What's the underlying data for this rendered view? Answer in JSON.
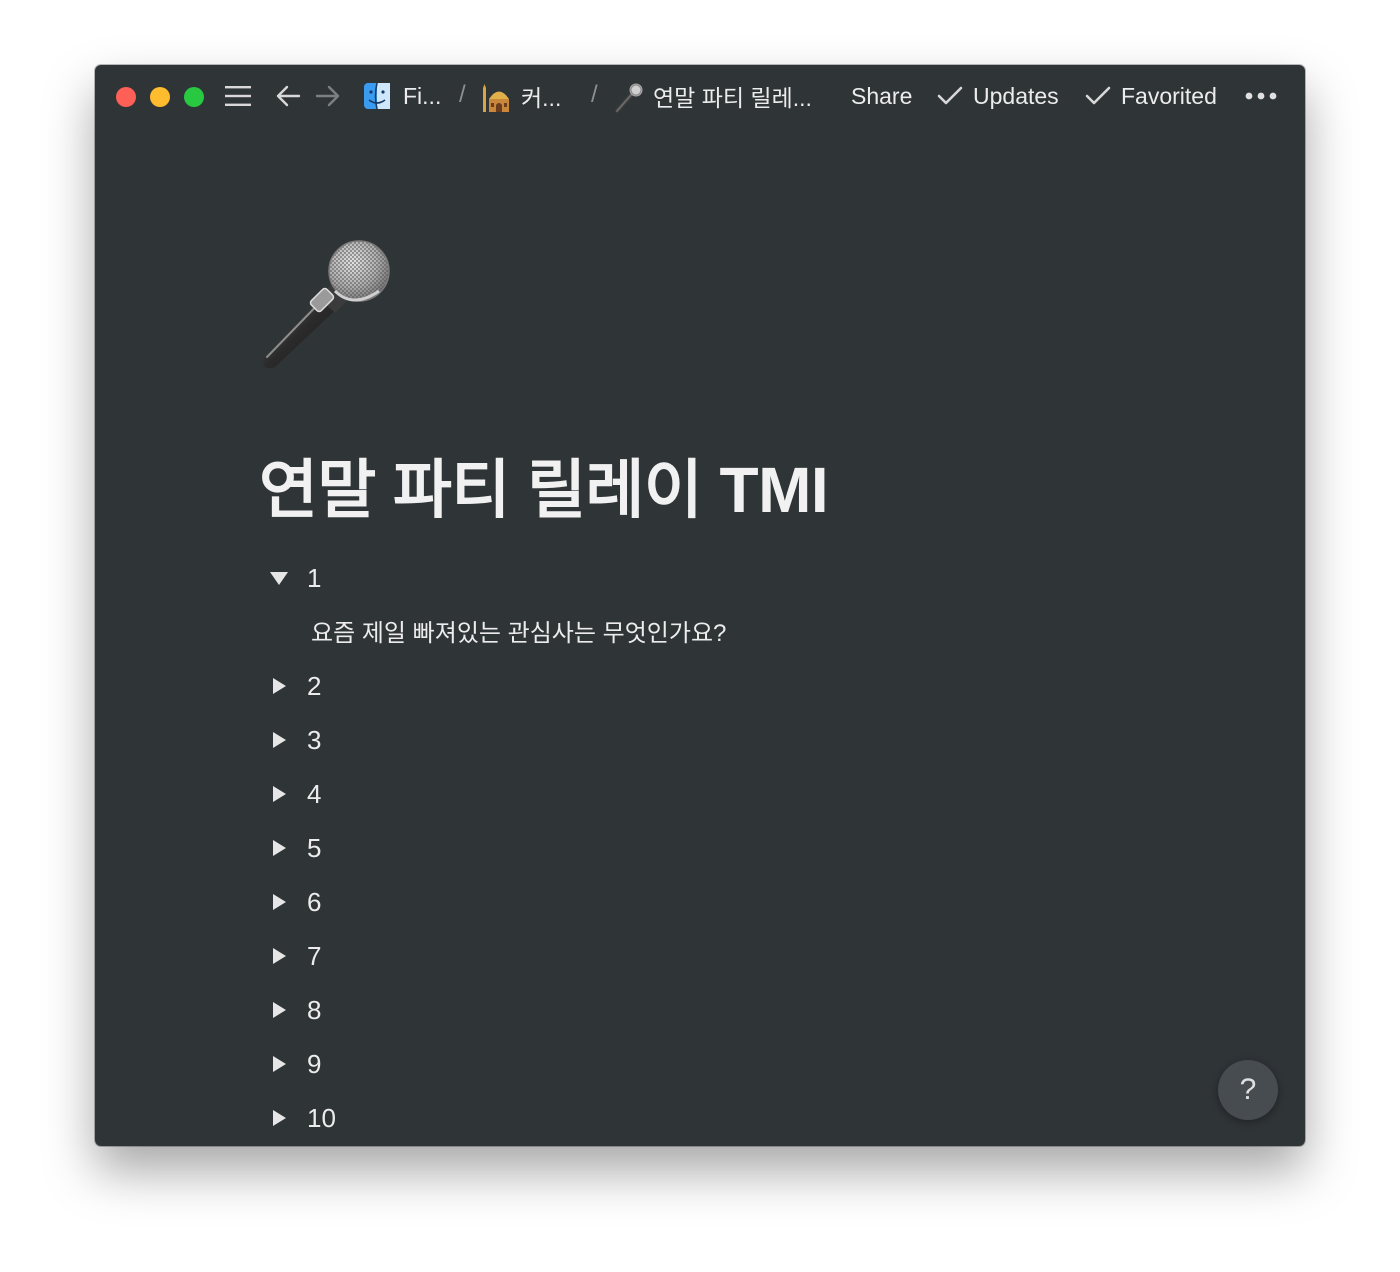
{
  "window": {
    "breadcrumbs": [
      {
        "label": "Fi...",
        "icon": "finder-icon"
      },
      {
        "label": "커...",
        "icon": "mosque-icon"
      },
      {
        "label": "연말 파티 릴레...",
        "icon": "microphone-icon"
      }
    ],
    "separator": "/"
  },
  "topbar": {
    "share_label": "Share",
    "updates_label": "Updates",
    "favorited_label": "Favorited"
  },
  "page": {
    "icon": "microphone-icon",
    "title": "연말 파티 릴레이 TMI",
    "toggles": [
      {
        "label": "1",
        "expanded": true,
        "content": "요즘 제일 빠져있는 관심사는 무엇인가요?"
      },
      {
        "label": "2",
        "expanded": false
      },
      {
        "label": "3",
        "expanded": false
      },
      {
        "label": "4",
        "expanded": false
      },
      {
        "label": "5",
        "expanded": false
      },
      {
        "label": "6",
        "expanded": false
      },
      {
        "label": "7",
        "expanded": false
      },
      {
        "label": "8",
        "expanded": false
      },
      {
        "label": "9",
        "expanded": false
      },
      {
        "label": "10",
        "expanded": false
      }
    ]
  },
  "help": {
    "label": "?"
  },
  "colors": {
    "background": "#2f3437",
    "text": "#ececec",
    "close": "#fe5f57",
    "minimize": "#febc2e",
    "maximize": "#28c840"
  }
}
